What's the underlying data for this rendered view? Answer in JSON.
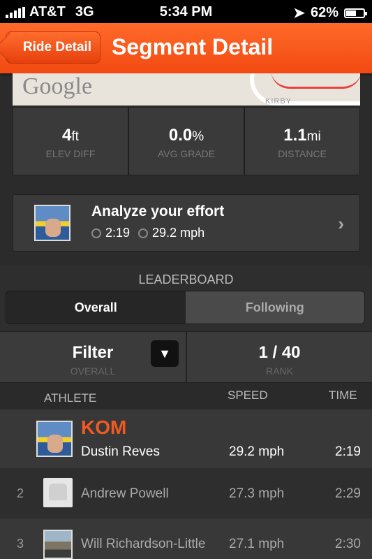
{
  "status": {
    "carrier": "AT&T",
    "network": "3G",
    "time": "5:34 PM",
    "battery": "62",
    "battery_unit": "%",
    "battery_level": 0.62
  },
  "nav": {
    "back_label": "Ride Detail",
    "title": "Segment Detail"
  },
  "map": {
    "logo": "Google",
    "street": "KIRBY"
  },
  "stats": [
    {
      "value": "4",
      "unit": "ft",
      "label": "ELEV DIFF"
    },
    {
      "value": "0.0",
      "unit": "%",
      "label": "AVG GRADE"
    },
    {
      "value": "1.1",
      "unit": "mi",
      "label": "DISTANCE"
    }
  ],
  "analyze": {
    "title": "Analyze your effort",
    "time": "2:19",
    "speed": "29.2 mph"
  },
  "leaderboard": {
    "heading": "LEADERBOARD",
    "tabs": [
      "Overall",
      "Following"
    ],
    "filter_label": "Filter",
    "filter_value": "OVERALL",
    "rank_value": "1 / 40",
    "rank_label": "RANK",
    "columns": {
      "athlete": "ATHLETE",
      "speed": "SPEED",
      "time": "TIME"
    },
    "kom_label": "KOM",
    "rows": [
      {
        "rank": "",
        "name": "Dustin Reves",
        "speed": "29.2 mph",
        "time": "2:19"
      },
      {
        "rank": "2",
        "name": "Andrew Powell",
        "speed": "27.3 mph",
        "time": "2:29"
      },
      {
        "rank": "3",
        "name": "Will Richardson-Little",
        "speed": "27.1 mph",
        "time": "2:30"
      }
    ]
  },
  "colors": {
    "accent": "#f24a12",
    "kom": "#f05a22"
  }
}
